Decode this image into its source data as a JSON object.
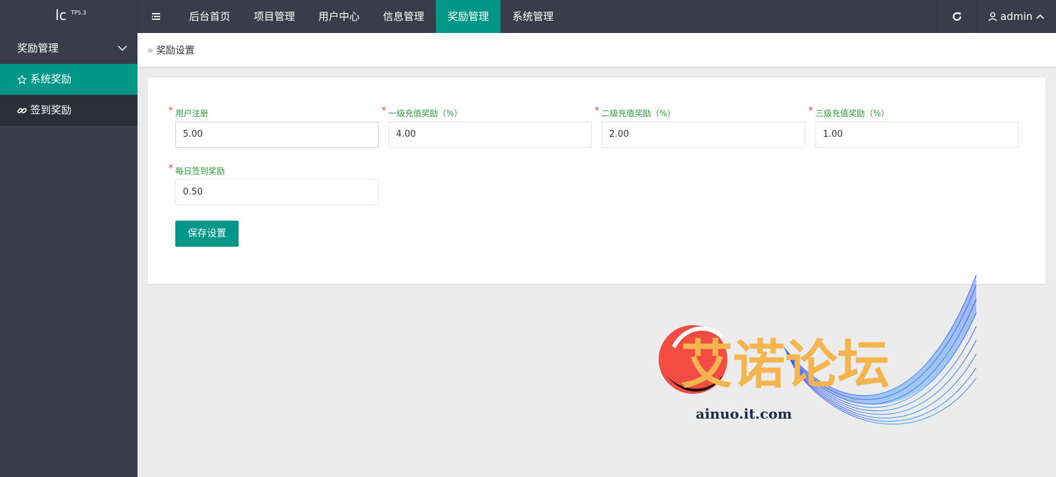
{
  "header": {
    "logo_text": "lc",
    "logo_version": "TP5.3",
    "nav": [
      {
        "label": "后台首页",
        "active": false
      },
      {
        "label": "项目管理",
        "active": false
      },
      {
        "label": "用户中心",
        "active": false
      },
      {
        "label": "信息管理",
        "active": false
      },
      {
        "label": "奖励管理",
        "active": true
      },
      {
        "label": "系统管理",
        "active": false
      }
    ],
    "user_label": "admin"
  },
  "sidebar": {
    "group_label": "奖励管理",
    "items": [
      {
        "label": "系统奖励",
        "icon": "star-icon",
        "active": true
      },
      {
        "label": "签到奖励",
        "icon": "link-icon",
        "active": false
      }
    ]
  },
  "breadcrumb": {
    "current": "奖励设置"
  },
  "form": {
    "fields": [
      {
        "label": "用户注册",
        "value": "5.00"
      },
      {
        "label": "一级充值奖励（%）",
        "value": "4.00"
      },
      {
        "label": "二级充值奖励（%）",
        "value": "2.00"
      },
      {
        "label": "三级充值奖励（%）",
        "value": "1.00"
      },
      {
        "label": "每日签到奖励",
        "value": "0.50"
      }
    ],
    "required_mark": "*",
    "save_label": "保存设置"
  },
  "watermark": {
    "title": "艾诺论坛",
    "url": "ainuo.it.com"
  },
  "colors": {
    "accent": "#009688",
    "topbar": "#393d49",
    "label_green": "#2a9b3c",
    "required_red": "#ff2a2a"
  }
}
